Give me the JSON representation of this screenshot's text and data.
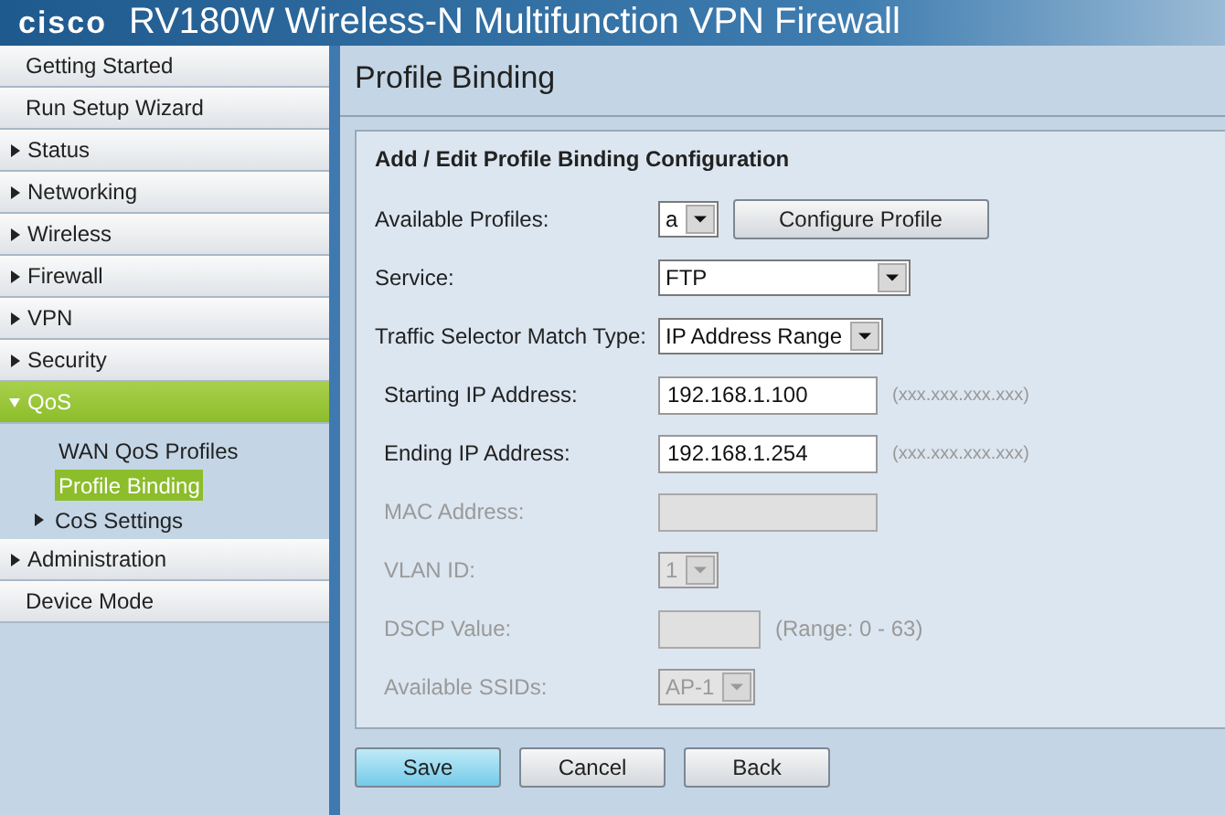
{
  "header": {
    "logo": "cisco",
    "title": "RV180W Wireless-N Multifunction VPN Firewall"
  },
  "sidebar": {
    "items": [
      {
        "label": "Getting Started",
        "kind": "link",
        "selected": false
      },
      {
        "label": "Run Setup Wizard",
        "kind": "link",
        "selected": false
      },
      {
        "label": "Status",
        "kind": "section",
        "selected": false,
        "expanded": false
      },
      {
        "label": "Networking",
        "kind": "section",
        "selected": false,
        "expanded": false
      },
      {
        "label": "Wireless",
        "kind": "section",
        "selected": false,
        "expanded": false
      },
      {
        "label": "Firewall",
        "kind": "section",
        "selected": false,
        "expanded": false
      },
      {
        "label": "VPN",
        "kind": "section",
        "selected": false,
        "expanded": false
      },
      {
        "label": "Security",
        "kind": "section",
        "selected": false,
        "expanded": false
      },
      {
        "label": "QoS",
        "kind": "section",
        "selected": true,
        "expanded": true,
        "children": [
          {
            "label": "WAN QoS Profiles",
            "kind": "link",
            "selected": false
          },
          {
            "label": "Profile Binding",
            "kind": "link",
            "selected": true
          },
          {
            "label": "CoS Settings",
            "kind": "section",
            "selected": false,
            "expanded": false
          }
        ]
      },
      {
        "label": "Administration",
        "kind": "section",
        "selected": false,
        "expanded": false
      },
      {
        "label": "Device Mode",
        "kind": "link",
        "selected": false
      }
    ]
  },
  "page": {
    "title": "Profile Binding",
    "panel": {
      "heading": "Add / Edit Profile Binding Configuration",
      "fields": [
        {
          "label": "Available Profiles:",
          "kind": "select",
          "value": "a",
          "disabled": false,
          "indented": false,
          "button": "Configure Profile"
        },
        {
          "label": "Service:",
          "kind": "select",
          "value": "FTP",
          "disabled": false,
          "indented": false
        },
        {
          "label": "Traffic Selector Match Type:",
          "kind": "select",
          "value": "IP Address Range",
          "disabled": false,
          "indented": false
        },
        {
          "label": "Starting IP Address:",
          "kind": "text",
          "value": "192.168.1.100",
          "disabled": false,
          "indented": true,
          "hint": "(xxx.xxx.xxx.xxx)"
        },
        {
          "label": "Ending IP Address:",
          "kind": "text",
          "value": "192.168.1.254",
          "disabled": false,
          "indented": true,
          "hint": "(xxx.xxx.xxx.xxx)"
        },
        {
          "label": "MAC Address:",
          "kind": "text",
          "disabled": true,
          "indented": true
        },
        {
          "label": "VLAN ID:",
          "kind": "select",
          "value": "1",
          "disabled": true,
          "indented": true
        },
        {
          "label": "DSCP Value:",
          "kind": "text",
          "disabled": true,
          "indented": true,
          "hint": "(Range: 0 - 63)"
        },
        {
          "label": "Available SSIDs:",
          "kind": "select",
          "value": "AP-1",
          "disabled": true,
          "indented": true
        }
      ]
    },
    "buttons": [
      {
        "label": "Save",
        "primary": true
      },
      {
        "label": "Cancel",
        "primary": false
      },
      {
        "label": "Back",
        "primary": false
      }
    ]
  }
}
